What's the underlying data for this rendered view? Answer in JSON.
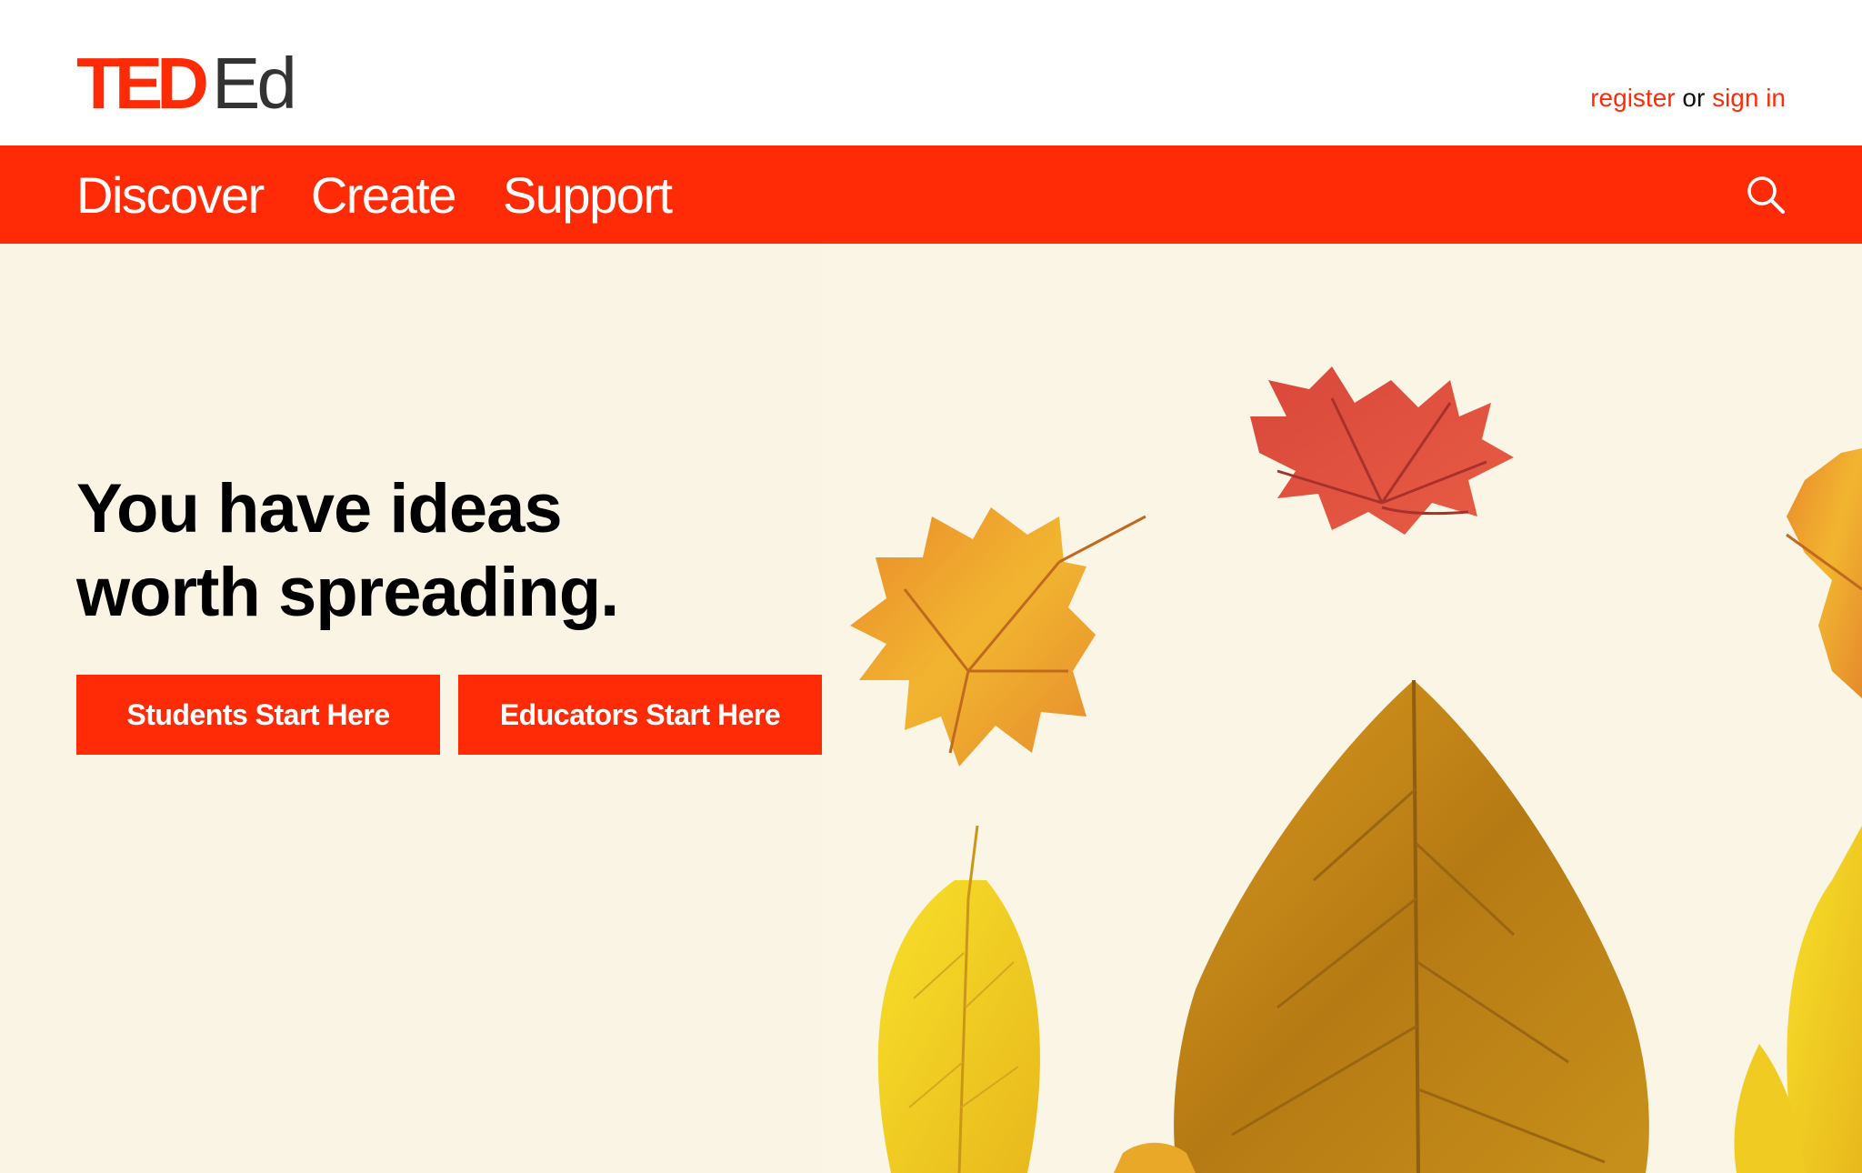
{
  "brand": {
    "ted": "TED",
    "ed": "Ed",
    "accent_color": "#ff2b06"
  },
  "auth": {
    "register_label": "register",
    "or_text": "or",
    "signin_label": "sign in"
  },
  "nav": {
    "items": [
      {
        "label": "Discover"
      },
      {
        "label": "Create"
      },
      {
        "label": "Support"
      }
    ],
    "search_icon": "search-icon"
  },
  "hero": {
    "title_line1": "You have ideas",
    "title_line2": "worth spreading.",
    "background_color": "#faf4e5",
    "buttons": {
      "students": "Students Start Here",
      "educators": "Educators Start Here"
    },
    "illustration": "autumn-leaves-illustration"
  }
}
